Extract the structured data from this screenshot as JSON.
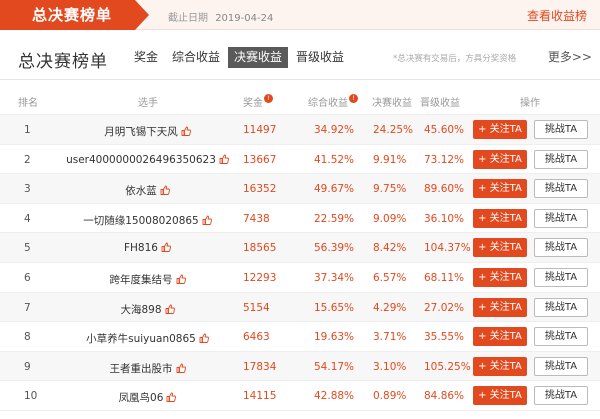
{
  "header": {
    "tab_label": "总决赛榜单",
    "deadline_label": "截止日期",
    "deadline_date": "2019-04-24",
    "view_rank_link": "查看收益榜"
  },
  "subheader": {
    "title": "总决赛榜单",
    "tabs": [
      {
        "label": "奖金",
        "active": false
      },
      {
        "label": "综合收益",
        "active": false
      },
      {
        "label": "决赛收益",
        "active": true
      },
      {
        "label": "晋级收益",
        "active": false
      }
    ],
    "note": "*总决赛有交易后，方具分奖资格",
    "more": "更多>>"
  },
  "table": {
    "headers": {
      "rank": "排名",
      "player": "选手",
      "prize": "奖金",
      "prize_badge": "!",
      "total": "综合收益",
      "total_badge": "!",
      "final": "决赛收益",
      "promo": "晋级收益",
      "action": "操作"
    },
    "follow_label": "+ 关注TA",
    "challenge_label": "挑战TA",
    "rows": [
      {
        "rank": "1",
        "player": "月明飞锡下天风",
        "prize": "11497",
        "total": "34.92%",
        "final": "24.25%",
        "promo": "45.60%"
      },
      {
        "rank": "2",
        "player": "user4000000026496350623",
        "prize": "13667",
        "total": "41.52%",
        "final": "9.91%",
        "promo": "73.12%"
      },
      {
        "rank": "3",
        "player": "依水蓝",
        "prize": "16352",
        "total": "49.67%",
        "final": "9.75%",
        "promo": "89.60%"
      },
      {
        "rank": "4",
        "player": "一切随缘15008020865",
        "prize": "7438",
        "total": "22.59%",
        "final": "9.09%",
        "promo": "36.10%"
      },
      {
        "rank": "5",
        "player": "FH816",
        "prize": "18565",
        "total": "56.39%",
        "final": "8.42%",
        "promo": "104.37%"
      },
      {
        "rank": "6",
        "player": "跨年度集结号",
        "prize": "12293",
        "total": "37.34%",
        "final": "6.57%",
        "promo": "68.11%"
      },
      {
        "rank": "7",
        "player": "大海898",
        "prize": "5154",
        "total": "15.65%",
        "final": "4.29%",
        "promo": "27.02%"
      },
      {
        "rank": "8",
        "player": "小草养牛suiyuan0865",
        "prize": "6463",
        "total": "19.63%",
        "final": "3.71%",
        "promo": "35.55%"
      },
      {
        "rank": "9",
        "player": "王者重出股市",
        "prize": "17834",
        "total": "54.17%",
        "final": "3.10%",
        "promo": "105.25%"
      },
      {
        "rank": "10",
        "player": "凤凰鸟06",
        "prize": "14115",
        "total": "42.88%",
        "final": "0.89%",
        "promo": "84.86%"
      }
    ]
  },
  "colors": {
    "accent": "#e2491e",
    "active_tab": "#5a5a5a",
    "banner_bg": "#fdf3ef"
  }
}
